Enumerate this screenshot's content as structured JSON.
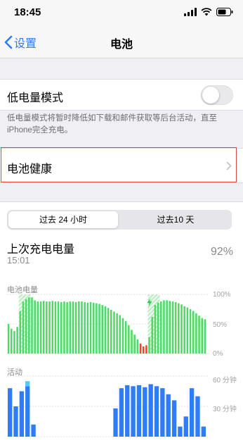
{
  "status": {
    "time": "18:45"
  },
  "nav": {
    "back_label": "设置",
    "title": "电池"
  },
  "low_power": {
    "label": "低电量模式",
    "enabled": false,
    "description": "低电量模式将暂时降低如下载和邮件获取等后台活动，直至iPhone完全充电。"
  },
  "battery_health": {
    "label": "电池健康"
  },
  "segments": {
    "items": [
      "过去 24 小时",
      "过去10 天"
    ],
    "selected": 0
  },
  "last_charge": {
    "title": "上次充电电量",
    "time": "15:01",
    "percent": "92%"
  },
  "battery_chart": {
    "title": "电池电量",
    "y_ticks": [
      "100%",
      "50%",
      "0%"
    ]
  },
  "activity_chart": {
    "title": "活动",
    "y_ticks": [
      "60 分钟",
      "30 分钟"
    ]
  },
  "colors": {
    "accent": "#2f7bf6",
    "battery_green": "#4cd964",
    "battery_red": "#ff3b30",
    "activity_blue": "#2e7cf6",
    "activity_light": "#5ac8fa"
  },
  "chart_data": [
    {
      "type": "bar",
      "title": "电池电量",
      "ylim": [
        0,
        100
      ],
      "values": [
        50,
        42,
        38,
        45,
        72,
        88,
        92,
        95,
        95,
        90,
        88,
        88,
        89,
        88,
        88,
        89,
        88,
        88,
        87,
        88,
        87,
        88,
        88,
        87,
        88,
        88,
        87,
        86,
        87,
        86,
        85,
        84,
        82,
        80,
        77,
        74,
        71,
        68,
        65,
        60,
        55,
        48,
        40,
        32,
        24,
        17,
        12,
        14,
        28,
        62,
        82,
        86,
        88,
        90,
        90,
        89,
        88,
        87,
        85,
        83,
        80,
        78,
        75,
        72,
        68,
        64,
        60,
        58
      ],
      "states": [
        "g",
        "g",
        "g",
        "g",
        "gc",
        "gc",
        "gc",
        "gc",
        "g",
        "g",
        "g",
        "g",
        "g",
        "g",
        "g",
        "g",
        "g",
        "g",
        "g",
        "g",
        "g",
        "g",
        "g",
        "g",
        "g",
        "g",
        "g",
        "g",
        "g",
        "g",
        "g",
        "g",
        "g",
        "g",
        "g",
        "g",
        "g",
        "g",
        "g",
        "g",
        "g",
        "g",
        "g",
        "g",
        "g",
        "r",
        "r",
        "r",
        "gc",
        "gc",
        "gc",
        "gc",
        "g",
        "g",
        "g",
        "g",
        "g",
        "g",
        "g",
        "g",
        "g",
        "g",
        "g",
        "g",
        "g",
        "g",
        "g",
        "g"
      ]
    },
    {
      "type": "bar",
      "title": "活动",
      "ylim": [
        0,
        60
      ],
      "values": [
        48,
        30,
        45,
        50,
        12,
        0,
        0,
        0,
        0,
        0,
        0,
        0,
        0,
        0,
        0,
        0,
        0,
        0,
        28,
        48,
        51,
        50,
        51,
        49,
        52,
        50,
        48,
        42,
        36,
        10,
        20,
        48,
        40,
        10
      ],
      "light": [
        0,
        0,
        0,
        5,
        0,
        0,
        0,
        0,
        0,
        0,
        0,
        0,
        0,
        0,
        0,
        0,
        0,
        0,
        0,
        0,
        0,
        0,
        0,
        0,
        0,
        0,
        0,
        0,
        0,
        0,
        0,
        0,
        0,
        0
      ]
    }
  ]
}
